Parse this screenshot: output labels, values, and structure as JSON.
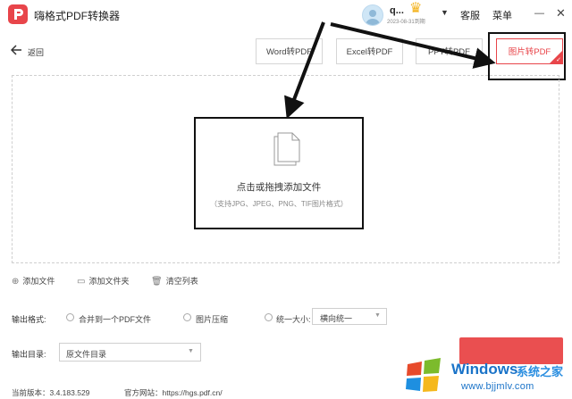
{
  "app": {
    "title": "嗨格式PDF转换器"
  },
  "account": {
    "username": "q...",
    "expire": "2023-08-31到期"
  },
  "header": {
    "service": "客服",
    "menu": "菜单",
    "minimize": "—",
    "close": "✕"
  },
  "back": {
    "label": "返回"
  },
  "tabs": [
    {
      "label": "Word转PDF"
    },
    {
      "label": "Excel转PDF"
    },
    {
      "label": "PPT转PDF"
    },
    {
      "label": "图片转PDF"
    }
  ],
  "active_tab": "图片转PDF",
  "drop": {
    "main": "点击或拖拽添加文件",
    "sub": "（支持JPG、JPEG、PNG、TIF图片格式）"
  },
  "actions": {
    "add_file": "添加文件",
    "add_folder": "添加文件夹",
    "clear_list": "清空列表"
  },
  "output_format": {
    "label": "输出格式:",
    "options": [
      "合并到一个PDF文件",
      "图片压缩",
      "统一大小:"
    ],
    "size_value": "横向统一"
  },
  "output_dir": {
    "label": "输出目录:",
    "value": "原文件目录"
  },
  "footer": {
    "version": "当前版本：3.4.183.529",
    "website": "官方网站：https://hgs.pdf.cn/"
  },
  "watermark": {
    "title": "Windows",
    "subtitle": "系统之家",
    "url": "www.bjjmlv.com"
  },
  "colors": {
    "accent": "#e8454a",
    "watermark_blue": "#1a73c8"
  }
}
